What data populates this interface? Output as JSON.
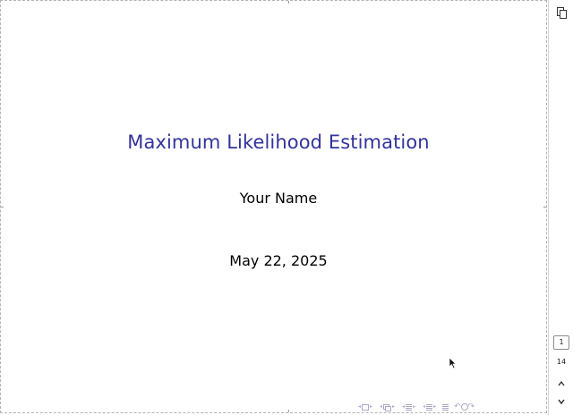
{
  "slide": {
    "title": "Maximum Likelihood Estimation",
    "author": "Your Name",
    "date": "May 22, 2025",
    "title_color": "#33339c"
  },
  "sidebar": {
    "current_page": "1",
    "total_pages": "14",
    "copy_icon": "copy-icon",
    "up_icon": "chevron-up-icon",
    "down_icon": "chevron-down-icon"
  },
  "navigation_symbols": [
    "slide-nav-icon",
    "frame-nav-icon",
    "subsection-nav-icon",
    "section-nav-icon",
    "document-nav-icon",
    "search-nav-icon"
  ]
}
